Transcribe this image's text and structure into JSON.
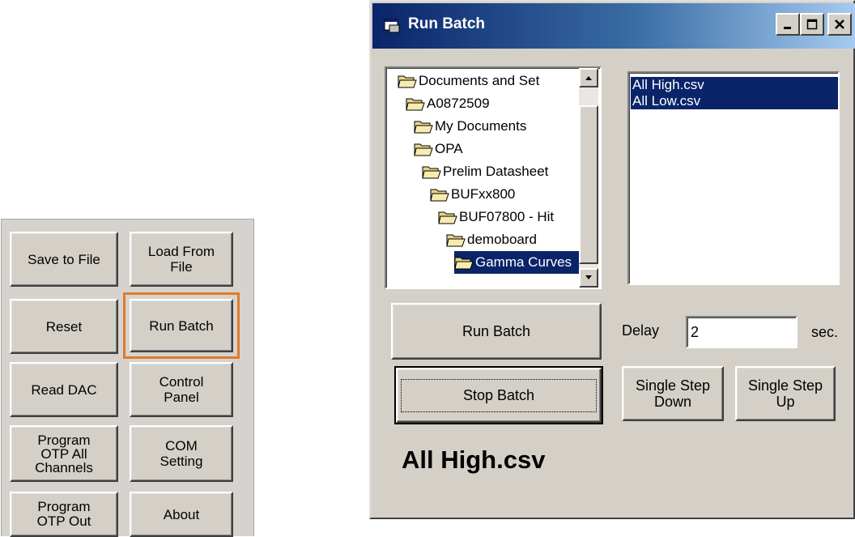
{
  "left_panel": {
    "buttons": {
      "save_to_file": "Save to File",
      "load_from_file": "Load From\nFile",
      "reset": "Reset",
      "run_batch": "Run Batch",
      "read_dac": "Read DAC",
      "control_panel": "Control\nPanel",
      "program_otp_all": "Program\nOTP All\nChannels",
      "com_setting": "COM\nSetting",
      "program_otp_out": "Program\nOTP Out",
      "about": "About"
    },
    "highlight_color": "#e07b28"
  },
  "dialog": {
    "title": "Run Batch",
    "title_icon": "window-app-icon",
    "caption_buttons": [
      "minimize-icon",
      "maximize-icon",
      "close-icon"
    ],
    "folder_tree": [
      {
        "label": "Documents and Set",
        "selected": false
      },
      {
        "label": "A0872509",
        "selected": false
      },
      {
        "label": "My Documents",
        "selected": false
      },
      {
        "label": "OPA",
        "selected": false
      },
      {
        "label": "Prelim Datasheet",
        "selected": false
      },
      {
        "label": "BUFxx800",
        "selected": false
      },
      {
        "label": "BUF07800 - Hit",
        "selected": false
      },
      {
        "label": "demoboard",
        "selected": false
      },
      {
        "label": "Gamma Curves",
        "selected": true
      }
    ],
    "files": [
      "All High.csv",
      "All Low.csv"
    ],
    "run_batch_label": "Run Batch",
    "stop_batch_label": "Stop Batch",
    "delay_label": "Delay",
    "delay_value": "2",
    "delay_unit": "sec.",
    "single_step_down_label": "Single Step\nDown",
    "single_step_up_label": "Single Step\nUp",
    "current_file": "All High.csv",
    "selection_color": "#0a246a"
  }
}
